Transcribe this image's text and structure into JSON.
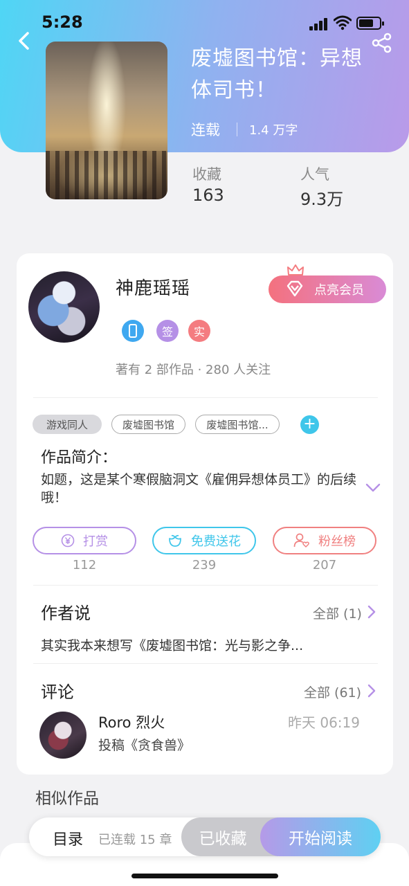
{
  "status_bar": {
    "time": "5:28"
  },
  "book": {
    "title": "废墟图书馆：异想体司书！",
    "status": "连载",
    "word_count": "1.4 万字",
    "stats": [
      {
        "label": "收藏",
        "value": "163"
      },
      {
        "label": "人气",
        "value": "9.3万"
      }
    ]
  },
  "author": {
    "name": "神鹿瑶瑶",
    "vip_label": "点亮会员",
    "badges": [
      {
        "text": "",
        "color": "#3fa8f0"
      },
      {
        "text": "签",
        "color": "#b590e6"
      },
      {
        "text": "实",
        "color": "#f47c80"
      }
    ],
    "meta": "著有 2 部作品 · 280 人关注"
  },
  "tags": [
    {
      "text": "游戏同人"
    },
    {
      "text": "废墟图书馆"
    },
    {
      "text": "废墟图书馆..."
    }
  ],
  "intro": {
    "title": "作品简介：",
    "text": "如题，这是某个寒假脑洞文《雇佣异想体员工》的后续哦！"
  },
  "actions": [
    {
      "label": "打赏",
      "count": "112",
      "color": "#b590e6"
    },
    {
      "label": "免费送花",
      "count": "239",
      "color": "#3fc6ea"
    },
    {
      "label": "粉丝榜",
      "count": "207",
      "color": "#f08080"
    }
  ],
  "author_says": {
    "title": "作者说",
    "link": "全部 (1)",
    "text": "其实我本来想写《废墟图书馆：光与影之争..."
  },
  "comments": {
    "title": "评论",
    "link": "全部 (61)",
    "items": [
      {
        "user": "Roro 烈火",
        "time": "昨天  06:19",
        "text": "投稿《贪食兽》"
      }
    ]
  },
  "similar": {
    "title": "相似作品"
  },
  "bottom_bar": {
    "toc": "目录",
    "chapters": "已连载 15 章",
    "favorited": "已收藏",
    "start_reading": "开始阅读"
  }
}
